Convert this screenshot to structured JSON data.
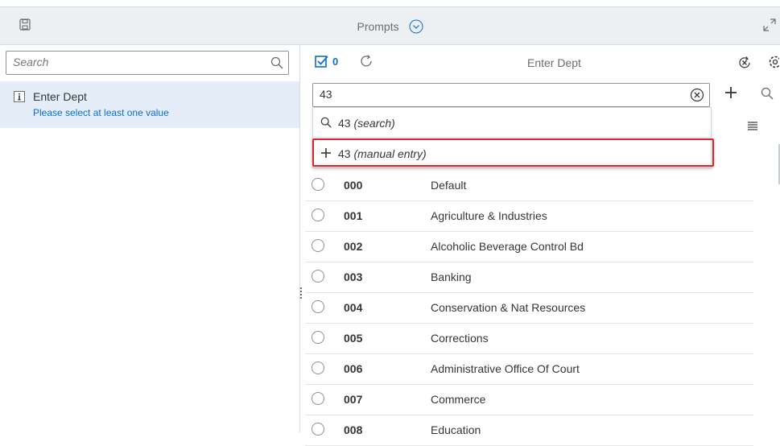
{
  "header": {
    "title": "Prompts",
    "save_icon": "save-icon",
    "expand_icon": "expand-icon"
  },
  "left_panel": {
    "search_placeholder": "Search",
    "items": [
      {
        "label": "Enter Dept",
        "hint": "Please select at least one value"
      }
    ]
  },
  "right_panel": {
    "title": "Enter Dept",
    "selected_count": "0",
    "input_value": "43",
    "suggestions": {
      "search_value": "43",
      "search_suffix": "(search)",
      "manual_value": "43",
      "manual_suffix": "(manual entry)"
    },
    "rows": [
      {
        "code": "000",
        "desc": "Default"
      },
      {
        "code": "001",
        "desc": "Agriculture & Industries"
      },
      {
        "code": "002",
        "desc": "Alcoholic Beverage Control Bd"
      },
      {
        "code": "003",
        "desc": "Banking"
      },
      {
        "code": "004",
        "desc": "Conservation & Nat Resources"
      },
      {
        "code": "005",
        "desc": "Corrections"
      },
      {
        "code": "006",
        "desc": "Administrative Office Of Court"
      },
      {
        "code": "007",
        "desc": "Commerce"
      },
      {
        "code": "008",
        "desc": "Education"
      }
    ]
  },
  "colors": {
    "accent": "#0a6ed1",
    "header_bg": "#edf0f3",
    "selected_item_bg": "#e5eef8",
    "highlight_border": "#e0222a"
  }
}
